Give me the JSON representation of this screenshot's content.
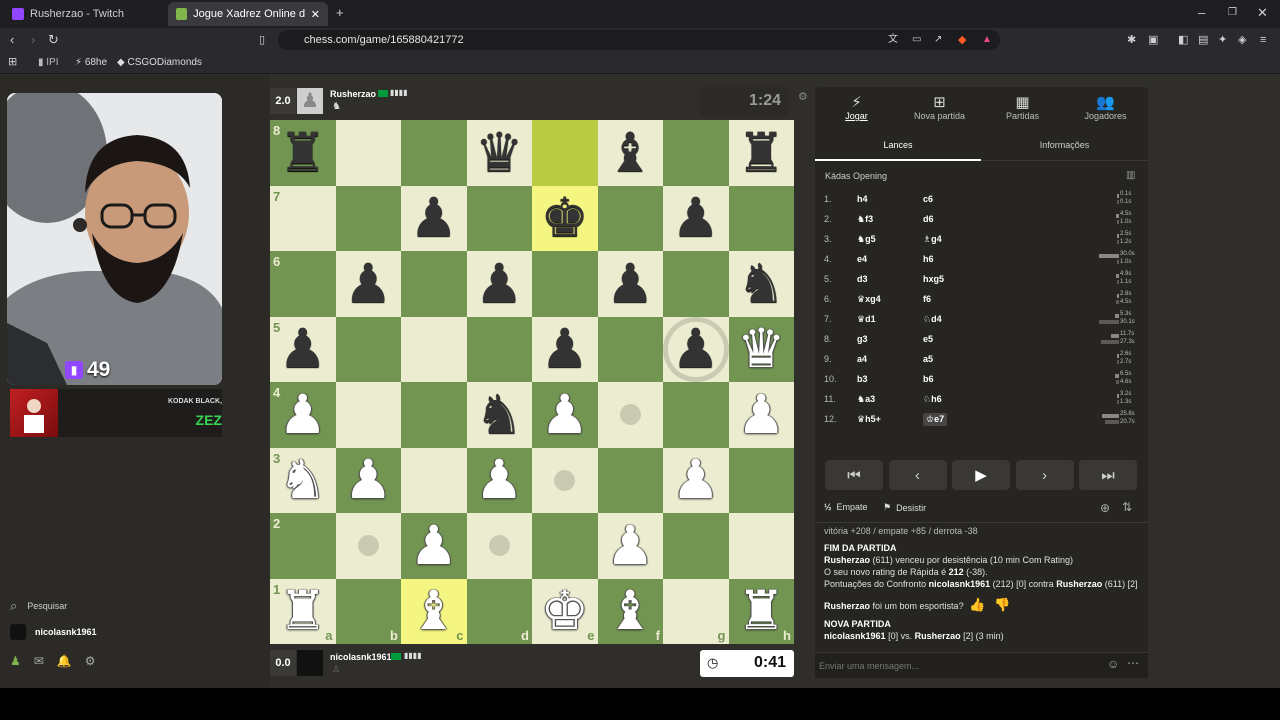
{
  "browser": {
    "tabs": [
      {
        "label": "Rusherzao - Twitch",
        "color": "#9146ff"
      },
      {
        "label": "Jogue Xadrez Online de GRAÇA",
        "color": "#81b64c"
      }
    ],
    "url": "chess.com/game/165880421772",
    "bookmarks": [
      "IPI",
      "68he",
      "CSGODiamonds"
    ]
  },
  "twitch": {
    "viewers": "49",
    "ad_text": "KODAK BLACK,",
    "ad_brand": "ZEZ",
    "search_label": "Pesquisar",
    "user": "nicolasnk1961"
  },
  "top_player": {
    "score": "2.0",
    "name": "Rusherzao",
    "flag": "BR",
    "clock": "1:24"
  },
  "bottom_player": {
    "score": "0.0",
    "name": "nicolasnk1961",
    "flag": "BR",
    "clock": "0:41"
  },
  "board": {
    "highlight_squares": [
      "e8",
      "e7",
      "c1"
    ],
    "move_dots": [
      "f4",
      "e3",
      "b2",
      "d2"
    ],
    "capture_ring": [
      "g5"
    ],
    "pieces": {
      "a8": "bR",
      "d8": "bQ",
      "f8": "bB",
      "h8": "bR",
      "c7": "bP",
      "e7": "bK",
      "g7": "bP",
      "b6": "bP",
      "d6": "bP",
      "f6": "bP",
      "h6": "bN",
      "a5": "bP",
      "e5": "bP",
      "g5": "bP",
      "h5": "wQ",
      "a4": "wP",
      "d4": "bN",
      "e4": "wP",
      "h4": "wP",
      "a3": "wN",
      "b3": "wP",
      "d3": "wP",
      "g3": "wP",
      "c2": "wP",
      "f2": "wP",
      "a1": "wR",
      "c1": "wB",
      "e1": "wK",
      "f1": "wB",
      "h1": "wR"
    }
  },
  "panel": {
    "top_tabs": [
      {
        "label": "Jogar",
        "icon": "bolt-icon",
        "glyph": "⚡"
      },
      {
        "label": "Nova partida",
        "icon": "plus-icon",
        "glyph": "⊞"
      },
      {
        "label": "Partidas",
        "icon": "grid-icon",
        "glyph": "▦"
      },
      {
        "label": "Jogadores",
        "icon": "players-icon",
        "glyph": "👥"
      }
    ],
    "sub_tabs": [
      "Lances",
      "Informações"
    ],
    "opening": "Kádas Opening",
    "moves": [
      {
        "n": "1.",
        "w": "h4",
        "b": "c6",
        "wt": "0.1s",
        "bt": "0.1s",
        "wf": 0.003,
        "bf": 0.003
      },
      {
        "n": "2.",
        "w": "♞f3",
        "b": "d6",
        "wt": "4.5s",
        "bt": "1.0s",
        "wf": 0.15,
        "bf": 0.033
      },
      {
        "n": "3.",
        "w": "♞g5",
        "b": "♗g4",
        "wt": "2.5s",
        "bt": "1.2s",
        "wf": 0.083,
        "bf": 0.04
      },
      {
        "n": "4.",
        "w": "e4",
        "b": "h6",
        "wt": "30.0s",
        "bt": "1.0s",
        "wf": 1.0,
        "bf": 0.033
      },
      {
        "n": "5.",
        "w": "d3",
        "b": "hxg5",
        "wt": "4.9s",
        "bt": "1.1s",
        "wf": 0.163,
        "bf": 0.037
      },
      {
        "n": "6.",
        "w": "♛xg4",
        "b": "f6",
        "wt": "2.8s",
        "bt": "4.5s",
        "wf": 0.093,
        "bf": 0.15
      },
      {
        "n": "7.",
        "w": "♛d1",
        "b": "♘d4",
        "wt": "5.3s",
        "bt": "30.1s",
        "wf": 0.177,
        "bf": 1.0
      },
      {
        "n": "8.",
        "w": "g3",
        "b": "e5",
        "wt": "11.7s",
        "bt": "27.3s",
        "wf": 0.39,
        "bf": 0.907
      },
      {
        "n": "9.",
        "w": "a4",
        "b": "a5",
        "wt": "2.6s",
        "bt": "2.7s",
        "wf": 0.087,
        "bf": 0.09
      },
      {
        "n": "10.",
        "w": "b3",
        "b": "b6",
        "wt": "6.5s",
        "bt": "4.6s",
        "wf": 0.217,
        "bf": 0.153
      },
      {
        "n": "11.",
        "w": "♞a3",
        "b": "♘h6",
        "wt": "3.2s",
        "bt": "1.3s",
        "wf": 0.107,
        "bf": 0.043
      },
      {
        "n": "12.",
        "w": "♛h5+",
        "b": "♔e7",
        "wt": "25.8s",
        "bt": "20.7s",
        "wf": 0.86,
        "bf": 0.69
      }
    ],
    "draw_label": "Empate",
    "resign_label": "Desistir",
    "result_summary": "vitória +208 / empate +85 / derrota -38",
    "game_over_title": "FIM DA PARTIDA",
    "winner": "Rusherzao",
    "winner_text": "(611) venceu por desistência (10 min Com Rating)",
    "rating_text": "O seu novo rating de Rápida é",
    "new_rating": "212",
    "rating_delta": "(-38).",
    "matchup_prefix": "Pontuações do Confronto",
    "matchup_p1": "nicolasnk1961",
    "matchup_mid": "(212) [0] contra",
    "matchup_p2": "Rusherzao",
    "matchup_suffix": "(611) [2]",
    "sportsman_name": "Rusherzao",
    "sportsman_text": "foi um bom esportista?",
    "new_game_title": "NOVA PARTIDA",
    "new_game_p1": "nicolasnk1961",
    "new_game_text": "[0] vs.",
    "new_game_p2": "Rusherzao",
    "new_game_suffix": "[2] (3 min)",
    "chat_placeholder": "Enviar uma mensagem..."
  }
}
